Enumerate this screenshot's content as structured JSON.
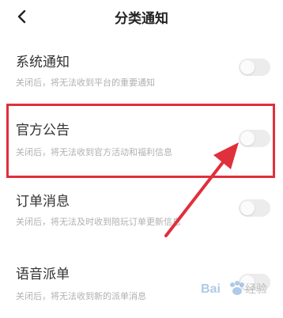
{
  "header": {
    "title": "分类通知",
    "back_icon": "chevron-left-icon"
  },
  "items": [
    {
      "title": "系统通知",
      "desc": "关闭后，将无法收到平台的重要通知",
      "enabled": false
    },
    {
      "title": "官方公告",
      "desc": "关闭后，将无法收到官方活动和福利信息",
      "enabled": false
    },
    {
      "title": "订单消息",
      "desc": "关闭后，将无法及时收到陪玩订单更新信息",
      "enabled": false
    },
    {
      "title": "语音派单",
      "desc": "关闭后，将无法收到新的派单消息",
      "enabled": false
    }
  ],
  "colors": {
    "annotation": "#e0303b",
    "toggle_off": "#ececec"
  },
  "watermark": {
    "text": "Bai 经验"
  }
}
